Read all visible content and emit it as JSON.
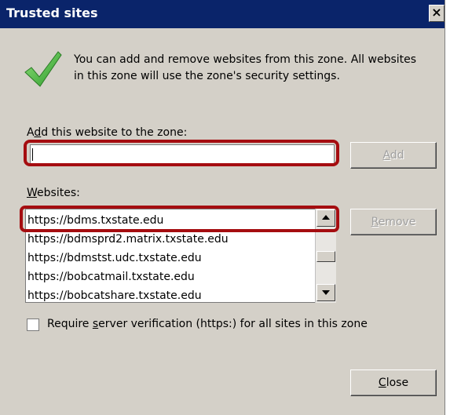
{
  "dialog": {
    "title": "Trusted sites",
    "close_glyph": "×",
    "check_icon": "green-checkmark-icon",
    "info_line1": "You can add and remove websites from this zone. All websites",
    "info_line2": "in this zone will use the zone's security settings.",
    "add_label_pre": "A",
    "add_label_ul": "d",
    "add_label_post": "d this website to the zone:",
    "add_input_value": "",
    "add_button_ul": "A",
    "add_button_post": "dd",
    "websites_label_ul": "W",
    "websites_label_post": "ebsites:",
    "websites": [
      "https://bdms.txstate.edu",
      "https://bdmsprd2.matrix.txstate.edu",
      "https://bdmstst.udc.txstate.edu",
      "https://bobcatmail.txstate.edu",
      "https://bobcatshare.txstate.edu"
    ],
    "remove_button_ul": "R",
    "remove_button_post": "emove",
    "require_pre": "Require ",
    "require_ul": "s",
    "require_post": "erver verification (https:) for all sites in this zone",
    "require_checked": false,
    "close_button_ul": "C",
    "close_button_post": "lose",
    "highlight_color": "#a50d10",
    "titlebar_color": "#0a246a"
  }
}
